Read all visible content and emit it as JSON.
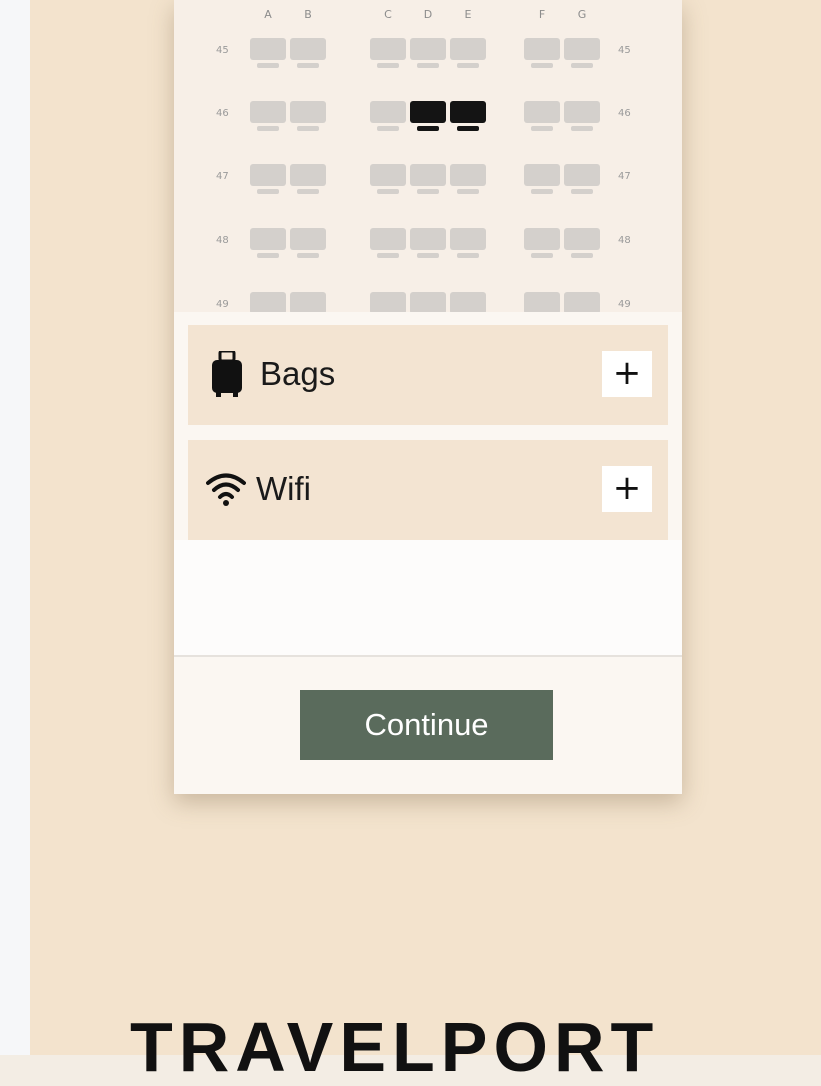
{
  "seat_map": {
    "columns": [
      "A",
      "B",
      "C",
      "D",
      "E",
      "F",
      "G"
    ],
    "rows": [
      "45",
      "46",
      "47",
      "48",
      "49"
    ],
    "selected_seats": [
      "46D",
      "46E"
    ]
  },
  "addons": [
    {
      "label": "Bags",
      "action": "+"
    },
    {
      "label": "Wifi",
      "action": "+"
    }
  ],
  "continue_label": "Continue",
  "logo_text": "TRAVELPORT",
  "colors": {
    "background": "#f3e3cd",
    "button": "#5a6b5c",
    "selected_seat": "#141414",
    "available_seat": "#d4d0cc"
  }
}
